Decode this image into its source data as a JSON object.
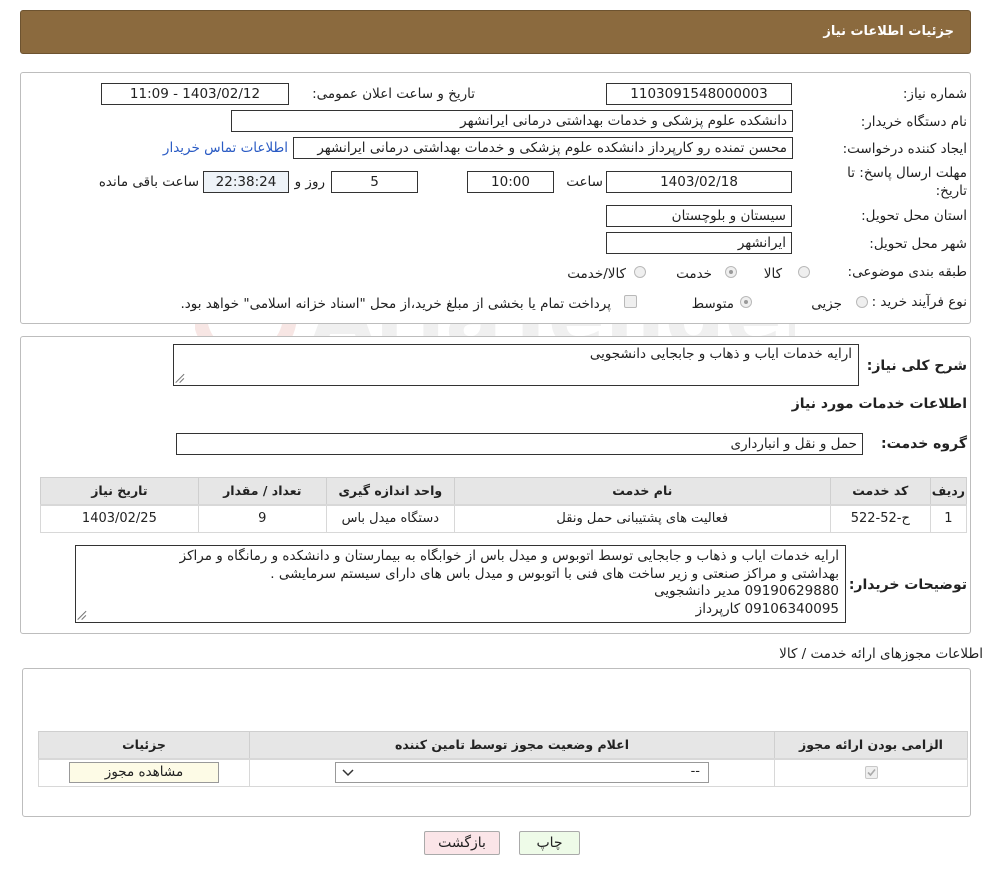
{
  "header": {
    "title": "جزئیات اطلاعات نیاز"
  },
  "fields": {
    "need_number_label": "شماره نیاز:",
    "need_number": "1103091548000003",
    "announce_label": "تاریخ و ساعت اعلان عمومی:",
    "announce_value": "1403/02/12 - 11:09",
    "buyer_org_label": "نام دستگاه خریدار:",
    "buyer_org": "دانشکده علوم پزشکی و خدمات بهداشتی درمانی ایرانشهر",
    "requester_label": "ایجاد کننده درخواست:",
    "requester": "محسن تمنده رو کارپرداز دانشکده علوم پزشکی و خدمات بهداشتی درمانی ایرانشهر",
    "contact_link": "اطلاعات تماس خریدار",
    "deadline_label_1": "مهلت ارسال پاسخ: تا",
    "deadline_label_2": "تاریخ:",
    "deadline_date": "1403/02/18",
    "time_label": "ساعت",
    "deadline_time": "10:00",
    "days_value": "5",
    "days_label": "روز و",
    "remaining_time": "22:38:24",
    "remaining_label": "ساعت باقی مانده",
    "province_label": "استان محل تحویل:",
    "province": "سیستان و بلوچستان",
    "city_label": "شهر محل تحویل:",
    "city": "ایرانشهر",
    "category_label": "طبقه بندی موضوعی:",
    "category_options": [
      "کالا",
      "خدمت",
      "کالا/خدمت"
    ],
    "category_selected": "خدمت",
    "purchase_type_label": "نوع فرآیند خرید :",
    "purchase_options": [
      "جزیی",
      "متوسط"
    ],
    "purchase_selected": "متوسط",
    "payment_note": "پرداخت تمام یا بخشی از مبلغ خرید،از محل \"اسناد خزانه اسلامی\" خواهد بود."
  },
  "general": {
    "desc_label": "شرح کلی نیاز:",
    "desc_value": "ارایه خدمات ایاب و ذهاب و جابجایی دانشجویی",
    "services_title": "اطلاعات خدمات مورد نیاز",
    "service_group_label": "گروه خدمت:",
    "service_group": "حمل و نقل و انبارداری"
  },
  "services_table": {
    "headers": [
      "ردیف",
      "کد خدمت",
      "نام خدمت",
      "واحد اندازه گیری",
      "تعداد / مقدار",
      "تاریخ نیاز"
    ],
    "rows": [
      [
        "1",
        "ح-52-522",
        "فعالیت های پشتیبانی حمل ونقل",
        "دستگاه میدل باس",
        "9",
        "1403/02/25"
      ]
    ]
  },
  "buyer_notes": {
    "label": "توضیحات خریدار:",
    "lines": [
      "ارایه خدمات ایاب و ذهاب و جابجایی توسط اتوبوس و میدل باس از خوابگاه به بیمارستان و دانشکده و رمانگاه و مراکز",
      "بهداشتی و مراکز صنعتی و زیر ساخت های فنی با اتوبوس و میدل باس های دارای سیستم سرمایشی .",
      "09190629880 مدیر دانشجویی",
      "09106340095 کارپرداز"
    ]
  },
  "permits": {
    "title": "اطلاعات مجوزهای ارائه خدمت / کالا",
    "headers": [
      "الزامی بودن ارائه مجوز",
      "اعلام وضعیت مجوز توسط تامین کننده",
      "جزئیات"
    ],
    "select_value": "--",
    "view_button": "مشاهده مجوز"
  },
  "footer": {
    "print_button": "چاپ",
    "back_button": "بازگشت"
  },
  "watermark_text": "AriaTender.neT",
  "colors": {
    "header_bg": "#8b6a3e",
    "link": "#2a5bc4",
    "back_button_bg": "#fbe5e8",
    "print_button_bg": "#eefbe8"
  }
}
